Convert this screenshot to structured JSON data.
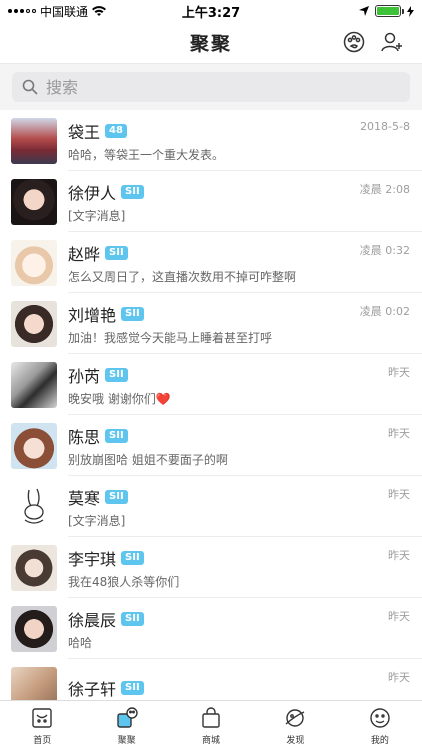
{
  "status_bar": {
    "carrier": "中国联通",
    "time": "上午3:27"
  },
  "nav": {
    "title": "聚聚"
  },
  "search": {
    "placeholder": "搜索"
  },
  "chats": [
    {
      "name": "袋王",
      "badge": "48",
      "time": "2018-5-8",
      "message": "哈哈，等袋王一个重大发表。"
    },
    {
      "name": "徐伊人",
      "badge": "SII",
      "time": "凌晨 2:08",
      "message": "[文字消息]"
    },
    {
      "name": "赵晔",
      "badge": "SII",
      "time": "凌晨 0:32",
      "message": "怎么又周日了，这直播次数用不掉可咋整啊"
    },
    {
      "name": "刘增艳",
      "badge": "SII",
      "time": "凌晨 0:02",
      "message": "加油！我感觉今天能马上睡着甚至打呼"
    },
    {
      "name": "孙芮",
      "badge": "SII",
      "time": "昨天",
      "message": "晚安哦 谢谢你们❤️"
    },
    {
      "name": "陈思",
      "badge": "SII",
      "time": "昨天",
      "message": "别放崩图哈 姐姐不要面子的啊"
    },
    {
      "name": "莫寒",
      "badge": "SII",
      "time": "昨天",
      "message": "[文字消息]"
    },
    {
      "name": "李宇琪",
      "badge": "SII",
      "time": "昨天",
      "message": "我在48狼人杀等你们"
    },
    {
      "name": "徐晨辰",
      "badge": "SII",
      "time": "昨天",
      "message": "哈哈"
    },
    {
      "name": "徐子轩",
      "badge": "SII",
      "time": "昨天",
      "message": ""
    }
  ],
  "tabs": [
    {
      "label": "首页",
      "icon": "home-icon"
    },
    {
      "label": "聚聚",
      "icon": "chat-icon"
    },
    {
      "label": "商城",
      "icon": "shop-bag-icon"
    },
    {
      "label": "发现",
      "icon": "planet-icon"
    },
    {
      "label": "我的",
      "icon": "face-icon"
    }
  ],
  "colors": {
    "badge": "#5ec6ee",
    "battery": "#3ec238",
    "active_tab": "#5ec6ee"
  }
}
